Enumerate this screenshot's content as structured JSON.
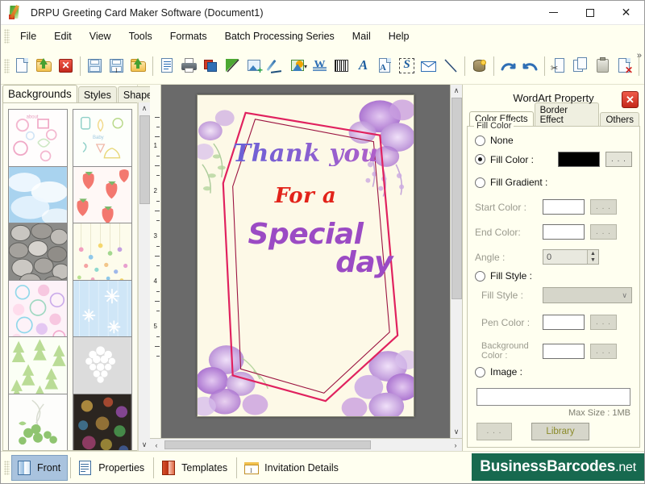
{
  "window": {
    "title": "DRPU Greeting Card Maker Software (Document1)",
    "icon": "app-pencil-icon",
    "minimize": "—",
    "maximize": "□",
    "close": "✕"
  },
  "menubar": {
    "items": [
      {
        "label": "File"
      },
      {
        "label": "Edit"
      },
      {
        "label": "View"
      },
      {
        "label": "Tools"
      },
      {
        "label": "Formats"
      },
      {
        "label": "Batch Processing Series"
      },
      {
        "label": "Mail"
      },
      {
        "label": "Help"
      }
    ]
  },
  "toolbar": {
    "overflow": "»",
    "buttons": [
      {
        "name": "new-document-icon"
      },
      {
        "name": "open-folder-icon"
      },
      {
        "name": "close-document-icon"
      },
      {
        "name": "save-icon"
      },
      {
        "name": "save-as-icon"
      },
      {
        "name": "export-folder-icon"
      },
      {
        "name": "page-setup-icon"
      },
      {
        "name": "print-icon"
      },
      {
        "name": "card-layers-icon"
      },
      {
        "name": "background-icon"
      },
      {
        "name": "insert-image-icon"
      },
      {
        "name": "pen-tool-icon"
      },
      {
        "name": "shape-tool-icon"
      },
      {
        "name": "wordart-icon"
      },
      {
        "name": "barcode-icon"
      },
      {
        "name": "text-icon"
      },
      {
        "name": "text-box-icon"
      },
      {
        "name": "signature-icon"
      },
      {
        "name": "envelope-icon"
      },
      {
        "name": "line-tool-icon"
      },
      {
        "name": "database-icon"
      },
      {
        "name": "undo-icon"
      },
      {
        "name": "redo-icon"
      },
      {
        "name": "cut-icon"
      },
      {
        "name": "copy-icon"
      },
      {
        "name": "paste-icon"
      },
      {
        "name": "delete-icon"
      }
    ]
  },
  "left_panel": {
    "tabs": [
      {
        "label": "Backgrounds",
        "active": true
      },
      {
        "label": "Styles",
        "active": false
      },
      {
        "label": "Shapes",
        "active": false
      }
    ],
    "scroll_up": "∧",
    "scroll_down": "∨",
    "thumbnails": [
      {
        "name": "background-thumb-baby-pink"
      },
      {
        "name": "background-thumb-baby-pastel"
      },
      {
        "name": "background-thumb-clouds"
      },
      {
        "name": "background-thumb-strawberry"
      },
      {
        "name": "background-thumb-stones"
      },
      {
        "name": "background-thumb-confetti"
      },
      {
        "name": "background-thumb-floral-pink"
      },
      {
        "name": "background-thumb-snowflake"
      },
      {
        "name": "background-thumb-pine-trees"
      },
      {
        "name": "background-thumb-white-heart"
      },
      {
        "name": "background-thumb-clover"
      },
      {
        "name": "background-thumb-fireworks"
      }
    ]
  },
  "canvas": {
    "ruler_numbers": [
      "1",
      "2",
      "3",
      "4",
      "5"
    ],
    "scroll_up": "∧",
    "scroll_down": "∨",
    "scroll_left": "‹",
    "scroll_right": "›",
    "card": {
      "line1": "Thank you",
      "line2": "For a",
      "line3": "Special",
      "line4": "day",
      "line1_color": "#7a60d4",
      "line2_color": "#e2231a",
      "line3_color": "#9b4bc4",
      "background_color": "#fdf9e7",
      "frame_color": "#e0215e"
    }
  },
  "right_panel": {
    "title": "WordArt Property",
    "close": "✕",
    "tabs": [
      {
        "label": "Color Effects",
        "active": true
      },
      {
        "label": "Border Effect",
        "active": false
      },
      {
        "label": "Others",
        "active": false
      }
    ],
    "group_label": "Fill Color",
    "options": {
      "none": "None",
      "fill_color": "Fill Color :",
      "fill_gradient": "Fill Gradient :",
      "fill_style": "Fill Style :",
      "image": "Image :"
    },
    "fields": {
      "start_color": "Start Color :",
      "end_color": "End Color:",
      "angle": "Angle :",
      "angle_value": "0",
      "fill_style": "Fill Style :",
      "pen_color": "Pen Color :",
      "background_color": "Background Color :"
    },
    "fill_color_value": "#000000",
    "browse_label": ". . .",
    "image_path": "",
    "max_size": "Max Size : 1MB",
    "library_label": "Library",
    "spin_up": "▲",
    "spin_down": "▼",
    "combo_arrow": "∨"
  },
  "statusbar": {
    "items": [
      {
        "label": "Front",
        "icon": "front-card-icon",
        "active": true
      },
      {
        "label": "Properties",
        "icon": "properties-icon",
        "active": false
      },
      {
        "label": "Templates",
        "icon": "templates-icon",
        "active": false
      },
      {
        "label": "Invitation Details",
        "icon": "invitation-details-icon",
        "active": false
      }
    ],
    "watermark": "BusinessBarcodes",
    "watermark_tld": ".net",
    "watermark_color": "#17694f"
  }
}
